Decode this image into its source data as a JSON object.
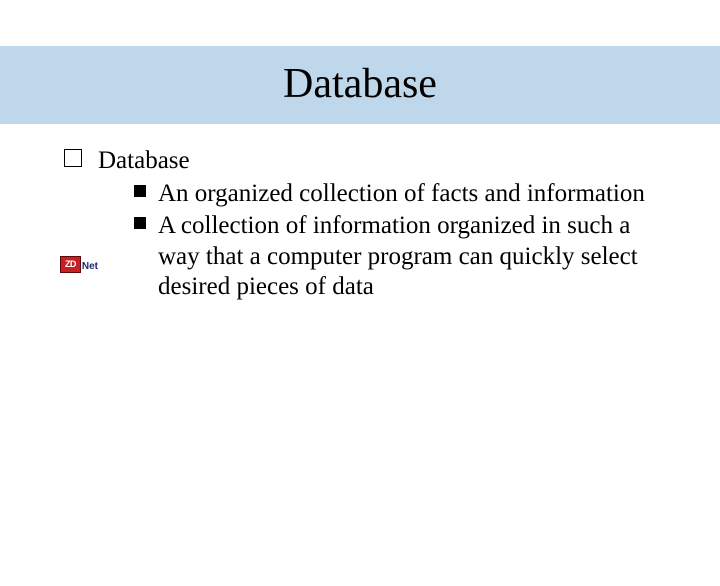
{
  "title": "Database",
  "bullet1": {
    "label": "Database",
    "sub1": "An organized collection of facts and information",
    "sub2": "A collection of information organized in such a way that a computer program can quickly select desired pieces of data"
  },
  "badge": {
    "main": "ZD",
    "tail": "Net"
  }
}
